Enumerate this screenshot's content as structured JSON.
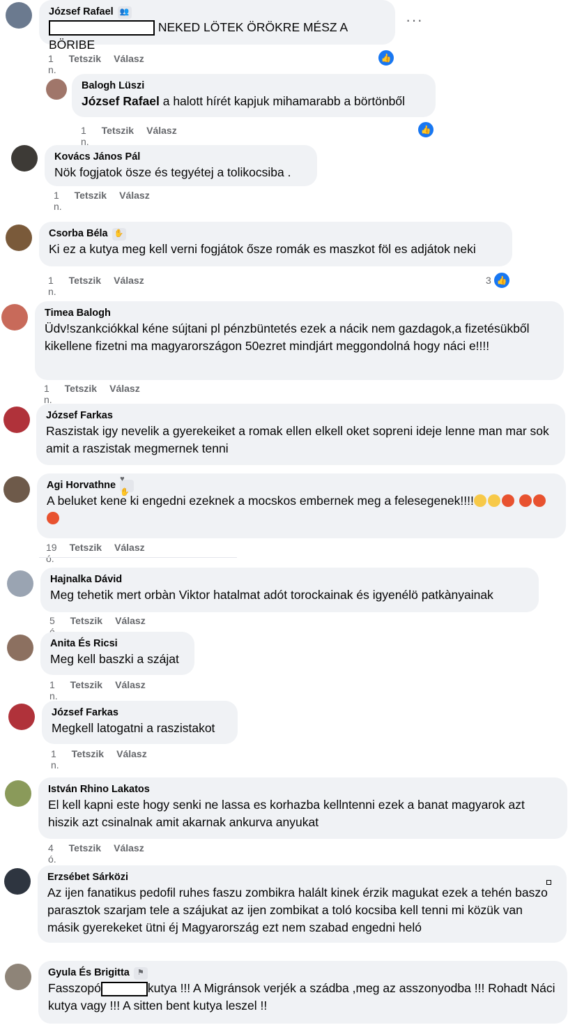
{
  "actions": {
    "like": "Tetszik",
    "reply": "Válasz"
  },
  "comments": [
    {
      "name": "József Rafael",
      "text": "NEKED LÖTEK ÖRÖKRE MÉSZ A BÖRIBE",
      "time": "1 n."
    },
    {
      "name": "Balogh Lüszi",
      "mention": "József Rafael",
      "text": "a halott hírét kapjuk mihamarabb a börtönből",
      "time": "1 n."
    },
    {
      "name": "Kovács János Pál",
      "text": "Nök fogjatok ösze és tegyétej a tolikocsiba .",
      "time": "1 n."
    },
    {
      "name": "Csorba Béla",
      "text": "Ki ez a kutya meg kell verni fogjátok ősze romák es maszkot föl es adjátok neki",
      "time": "1 n.",
      "likes": "3"
    },
    {
      "name": "Timea Balogh",
      "text": "Üdv!szankciókkal kéne sújtani pl pénzbüntetés ezek a nácik nem gazdagok,a fizetésükből kikellene fizetni ma magyarországon 50ezret mindjárt meggondolná hogy náci e!!!!",
      "time": "1 n."
    },
    {
      "name": "József Farkas",
      "text": "Raszistak igy nevelik a gyerekeiket a romak ellen elkell oket sopreni ideje lenne man mar sok amit a raszistak megmernek tenni"
    },
    {
      "name": "Agi Horvathne",
      "text": "A beluket kene ki engedni ezeknek a mocskos embernek meg a felesegenek!!!!",
      "time": "19 ó."
    },
    {
      "name": "Hajnalka Dávid",
      "text": "Meg tehetik mert orbàn Viktor hatalmat adót torockainak és igyenélö patkànyainak",
      "time": "5 ó."
    },
    {
      "name": "Anita És Ricsi",
      "text": "Meg kell baszki a szájat",
      "time": "1 n."
    },
    {
      "name": "József Farkas",
      "text": "Megkell latogatni a raszistakot",
      "time": "1 n."
    },
    {
      "name": "István Rhino Lakatos",
      "text": "El kell kapni este hogy senki ne lassa es korhazba kellntenni ezek a banat magyarok azt hiszik azt csinalnak amit akarnak ankurva anyukat",
      "time": "4 ó."
    },
    {
      "name": "Erzsébet Sárközi",
      "text": "Az ijen fanatikus pedofil ruhes faszu zombikra halált kinek érzik magukat ezek a tehén baszo parasztok szarjam tele a szájukat az ijen zombikat a toló kocsiba kell tenni mi közük van másik gyerekeket ütni éj Magyarország ezt nem szabad engedni heló"
    },
    {
      "name": "Gyula És Brigitta",
      "text_a": "Fasszopó",
      "text_b": "kutya !!! A Migránsok verjék a szádba ,meg az asszonyodba !!! Rohadt Náci kutya vagy !!! A sitten bent kutya leszel !!"
    }
  ]
}
